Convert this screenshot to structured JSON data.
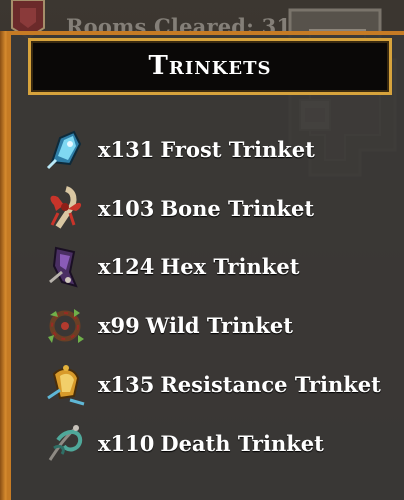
{
  "hud": {
    "rooms_cleared_text": "Rooms Cleared: 31"
  },
  "panel": {
    "title": "Trinkets",
    "items": [
      {
        "quantity": "x131",
        "name": "Frost Trinket",
        "icon": "frost-trinket-icon",
        "color": "#5fc6e8"
      },
      {
        "quantity": "x103",
        "name": "Bone Trinket",
        "icon": "bone-trinket-icon",
        "color": "#d84a3c"
      },
      {
        "quantity": "x124",
        "name": "Hex Trinket",
        "icon": "hex-trinket-icon",
        "color": "#8a5bb8"
      },
      {
        "quantity": "x99",
        "name": "Wild Trinket",
        "icon": "wild-trinket-icon",
        "color": "#6fb04a"
      },
      {
        "quantity": "x135",
        "name": "Resistance Trinket",
        "icon": "resistance-trinket-icon",
        "color": "#e3b23c"
      },
      {
        "quantity": "x110",
        "name": "Death Trinket",
        "icon": "death-trinket-icon",
        "color": "#4fa89a"
      }
    ]
  },
  "colors": {
    "panel_border": "#c67b24",
    "title_border": "#d7a33c",
    "panel_bg": "#3a3836",
    "text": "#ffffff"
  }
}
